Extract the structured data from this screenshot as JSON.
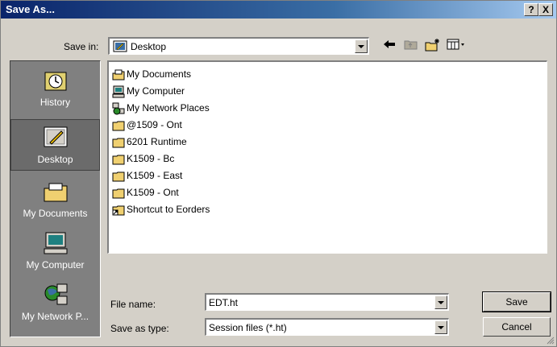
{
  "window": {
    "title": "Save As..."
  },
  "title_buttons": {
    "help": "?",
    "close": "X"
  },
  "save_in": {
    "label": "Save in:",
    "value": "Desktop"
  },
  "places": [
    {
      "label": "History",
      "icon": "history-icon"
    },
    {
      "label": "Desktop",
      "icon": "desktop-icon",
      "selected": true
    },
    {
      "label": "My Documents",
      "icon": "my-documents-icon"
    },
    {
      "label": "My Computer",
      "icon": "my-computer-icon"
    },
    {
      "label": "My Network P...",
      "icon": "my-network-places-icon"
    }
  ],
  "files": [
    {
      "name": "My Documents",
      "icon": "my-documents-icon"
    },
    {
      "name": "My Computer",
      "icon": "my-computer-icon"
    },
    {
      "name": "My Network Places",
      "icon": "network-icon"
    },
    {
      "name": "@1509 - Ont",
      "icon": "folder-icon"
    },
    {
      "name": "6201 Runtime",
      "icon": "folder-icon"
    },
    {
      "name": "K1509 - Bc",
      "icon": "folder-icon"
    },
    {
      "name": "K1509 - East",
      "icon": "folder-icon"
    },
    {
      "name": "K1509 - Ont",
      "icon": "folder-icon"
    },
    {
      "name": "Shortcut to Eorders",
      "icon": "shortcut-icon"
    }
  ],
  "file_name": {
    "label": "File name:",
    "value": "EDT.ht"
  },
  "save_as_type": {
    "label": "Save as type:",
    "value": "Session files (*.ht)"
  },
  "buttons": {
    "save": "Save",
    "cancel": "Cancel"
  }
}
